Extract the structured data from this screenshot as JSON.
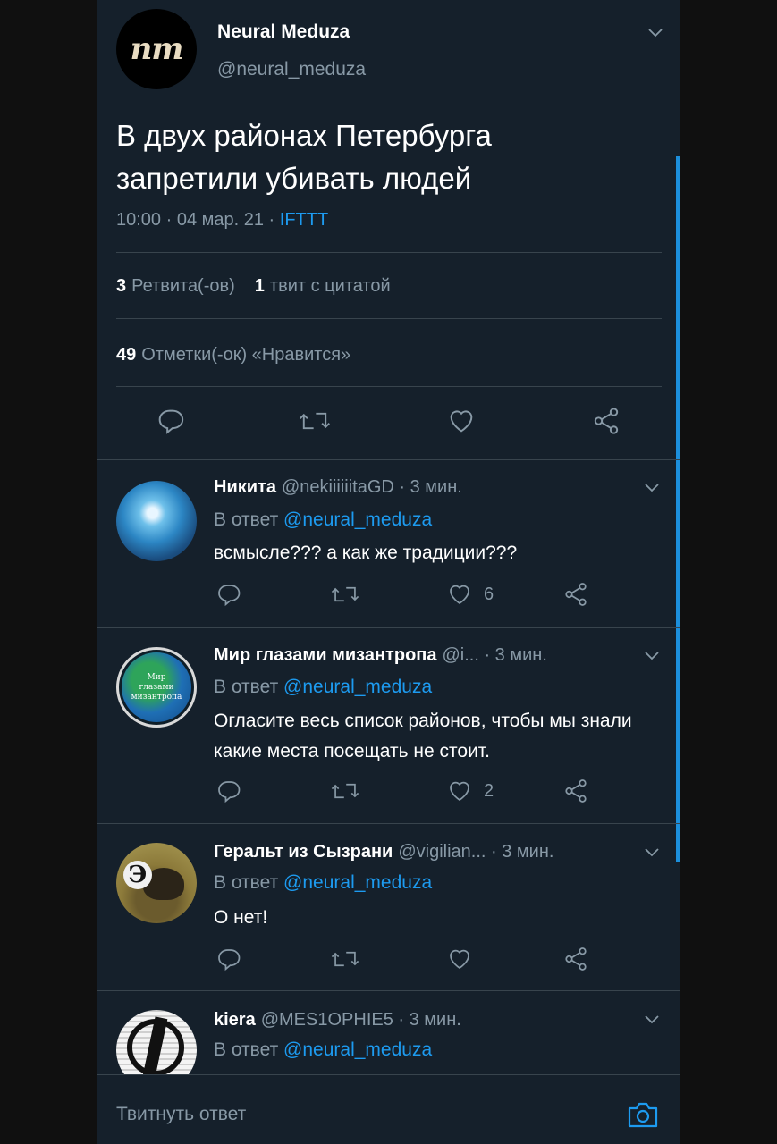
{
  "main_tweet": {
    "avatar_text": "nm",
    "name": "Neural Meduza",
    "handle": "@neural_meduza",
    "text": "В двух районах Петербурга запретили убивать людей",
    "time": "10:00 · 04 мар. 21 · ",
    "source": "IFTTT",
    "retweets_count": "3",
    "retweets_label": "Ретвита(-ов)",
    "quotes_count": "1",
    "quotes_label": "твит с цитатой",
    "likes_count": "49",
    "likes_label": "Отметки(-ок) «Нравится»"
  },
  "replies": [
    {
      "name": "Никита",
      "meta": "@nekiiiiiitaGD · 3 мин.",
      "reply_to_label": "В ответ ",
      "mention": "@neural_meduza",
      "text": "всмысле??? а как же традиции???",
      "like_count": "6"
    },
    {
      "name": "Мир глазами мизантропа",
      "meta": "@i... · 3 мин.",
      "avatar_text": [
        "Мир",
        "глазами",
        "мизантропа"
      ],
      "reply_to_label": "В ответ ",
      "mention": "@neural_meduza",
      "text": "Огласите весь список районов, чтобы мы знали какие места посещать не стоит.",
      "like_count": "2"
    },
    {
      "name": "Геральт из Сызрани",
      "meta": "@vigilian... · 3 мин.",
      "avatar_letter": "Э",
      "reply_to_label": "В ответ ",
      "mention": "@neural_meduza",
      "text": "О нет!",
      "like_count": ""
    },
    {
      "name": "kiera",
      "meta": "@MES1OPHIE5 · 3 мин.",
      "reply_to_label": "В ответ ",
      "mention": "@neural_meduza"
    }
  ],
  "compose": {
    "placeholder": "Твитнуть ответ"
  },
  "icons": {
    "reply": "reply-icon",
    "retweet": "retweet-icon",
    "like": "heart-icon",
    "share": "share-icon",
    "more": "chevron-down-icon",
    "camera": "camera-icon"
  },
  "colors": {
    "background": "#15202b",
    "accent": "#1d9bf0",
    "secondary_text": "#8899a6",
    "divider": "#38444d"
  }
}
